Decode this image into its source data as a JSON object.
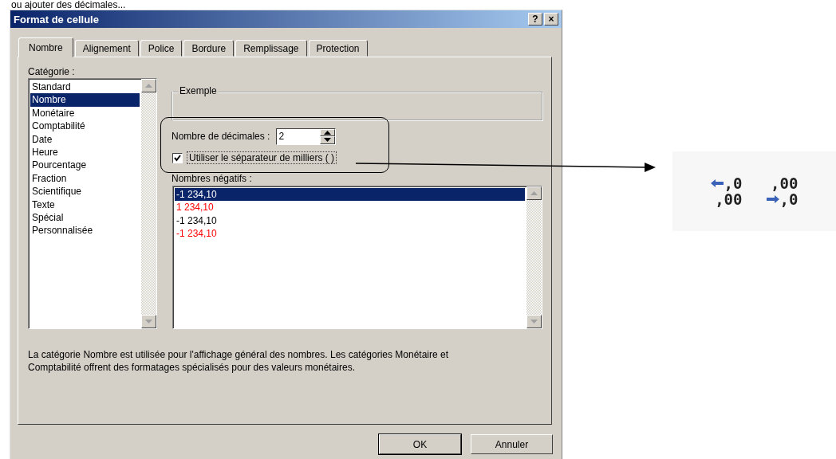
{
  "caption": "ou ajouter des décimales...",
  "window": {
    "title": "Format de cellule",
    "help_button": "?",
    "close_button": "×"
  },
  "tabs": [
    {
      "label": "Nombre",
      "selected": true
    },
    {
      "label": "Alignement",
      "selected": false
    },
    {
      "label": "Police",
      "selected": false
    },
    {
      "label": "Bordure",
      "selected": false
    },
    {
      "label": "Remplissage",
      "selected": false
    },
    {
      "label": "Protection",
      "selected": false
    }
  ],
  "category": {
    "label": "Catégorie :",
    "items": [
      {
        "label": "Standard",
        "selected": false
      },
      {
        "label": "Nombre",
        "selected": true
      },
      {
        "label": "Monétaire",
        "selected": false
      },
      {
        "label": "Comptabilité",
        "selected": false
      },
      {
        "label": "Date",
        "selected": false
      },
      {
        "label": "Heure",
        "selected": false
      },
      {
        "label": "Pourcentage",
        "selected": false
      },
      {
        "label": "Fraction",
        "selected": false
      },
      {
        "label": "Scientifique",
        "selected": false
      },
      {
        "label": "Texte",
        "selected": false
      },
      {
        "label": "Spécial",
        "selected": false
      },
      {
        "label": "Personnalisée",
        "selected": false
      }
    ]
  },
  "example": {
    "label": "Exemple"
  },
  "decimals": {
    "label": "Nombre de décimales :",
    "value": "2"
  },
  "thousands_separator": {
    "label": "Utiliser le séparateur de milliers ( )",
    "checked": true
  },
  "negative_numbers": {
    "label": "Nombres négatifs :",
    "items": [
      {
        "label": "-1 234,10",
        "selected": true,
        "color": "#ffffff"
      },
      {
        "label": "1 234,10",
        "selected": false,
        "color": "#ff0000"
      },
      {
        "label": "-1 234,10",
        "selected": false,
        "color": "#000000"
      },
      {
        "label": "-1 234,10",
        "selected": false,
        "color": "#ff0000"
      }
    ]
  },
  "description": "La catégorie Nombre est utilisée pour l'affichage général des nombres. Les catégories Monétaire et Comptabilité offrent des formatages spécialisés pour des valeurs monétaires.",
  "buttons": [
    {
      "label": "OK",
      "default": true
    },
    {
      "label": "Annuler",
      "default": false
    }
  ],
  "decimal_buttons": [
    {
      "kind": "increase",
      "top": ",0",
      "bottom": ",00"
    },
    {
      "kind": "decrease",
      "top": ",00",
      "bottom": ",0"
    }
  ]
}
